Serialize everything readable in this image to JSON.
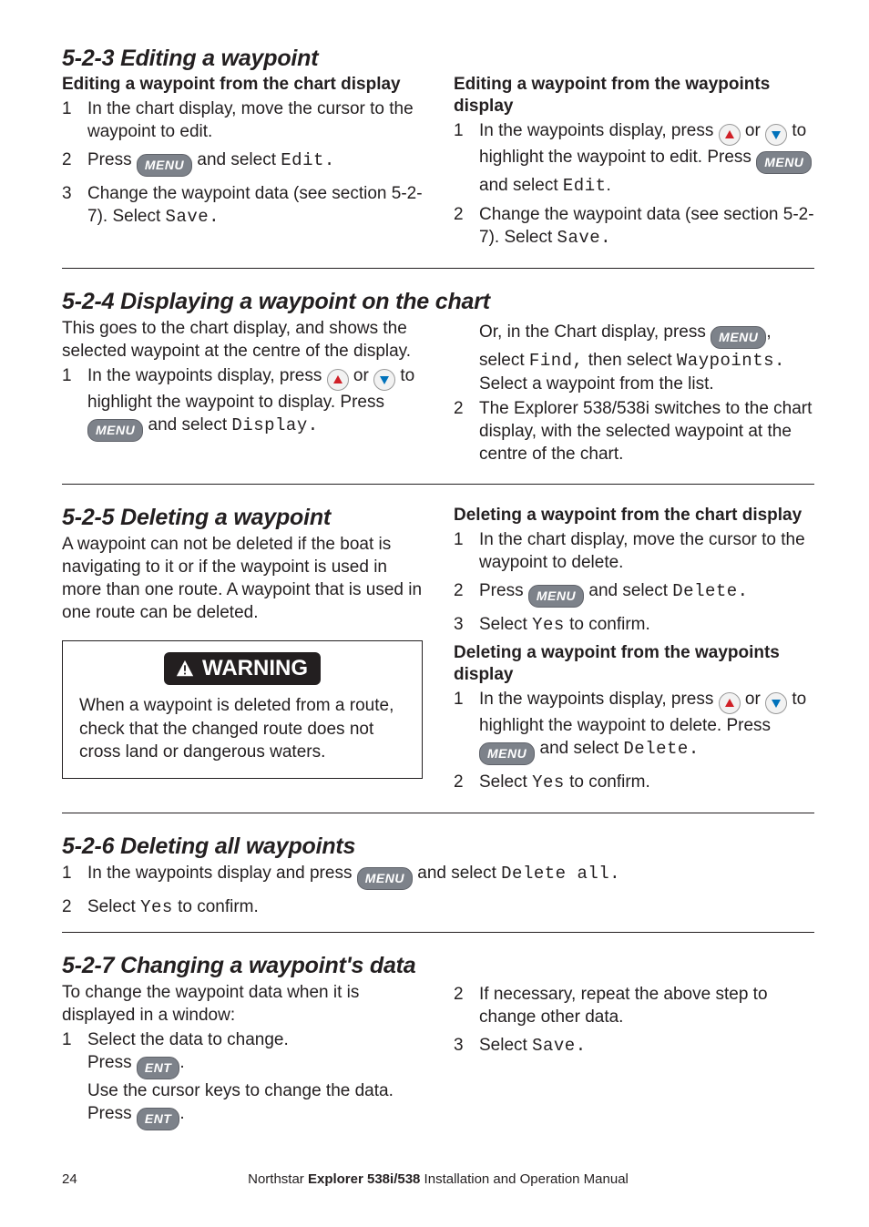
{
  "buttons": {
    "menu": "MENU",
    "ent": "ENT"
  },
  "s523": {
    "title": "5-2-3 Editing a waypoint",
    "left": {
      "heading": "Editing a waypoint from the chart display",
      "step1": "In the chart display, move the cursor to the waypoint to edit.",
      "step2a": "Press ",
      "step2b": " and select ",
      "step2c": "Edit.",
      "step3a": "Change the waypoint data (see section 5-2-7). Select ",
      "step3b": "Save."
    },
    "right": {
      "heading": "Editing a waypoint from the waypoints display",
      "step1a": "In the waypoints display, press ",
      "step1b": " or ",
      "step1c": " to highlight the waypoint to edit. Press ",
      "step1d": " and select ",
      "step1e": "Edit",
      "step1f": ".",
      "step2a": "Change the waypoint data (see section 5-2-7). Select ",
      "step2b": "Save."
    }
  },
  "s524": {
    "title": "5-2-4 Displaying a waypoint on the chart",
    "left": {
      "intro": "This goes to the chart display, and shows the selected waypoint at the centre of the display.",
      "step1a": "In the waypoints display, press ",
      "step1b": " or ",
      "step1c": " to highlight the waypoint to display. Press ",
      "step1d": " and select ",
      "step1e": "Display."
    },
    "right": {
      "alt1": "Or, in the Chart display, press ",
      "alt2": ", select ",
      "alt3": "Find,",
      "alt4": " then select ",
      "alt5": "Waypoints.",
      "alt6": " Select a waypoint from the list.",
      "step2": "The Explorer 538/538i switches to the chart display, with the selected waypoint at the centre of the chart."
    }
  },
  "s525": {
    "title": "5-2-5 Deleting a waypoint",
    "left": {
      "intro": "A waypoint can not be deleted if the boat is navigating to it or if the waypoint is used in more than one route. A waypoint that is used in one route can be deleted.",
      "warn_label": "WARNING",
      "warn_body": "When a waypoint is deleted from a route, check that the changed route does not cross land or dangerous waters."
    },
    "right": {
      "heading1": "Deleting a waypoint from the chart display",
      "a1": "In the chart display, move the cursor to the waypoint to delete.",
      "a2a": "Press ",
      "a2b": " and select ",
      "a2c": "Delete.",
      "a3a": "Select ",
      "a3b": "Yes",
      "a3c": " to confirm.",
      "heading2": "Deleting a waypoint from the waypoints display",
      "b1a": "In the waypoints display, press ",
      "b1b": " or ",
      "b1c": " to highlight the waypoint to delete. Press ",
      "b1d": " and select ",
      "b1e": "Delete.",
      "b2a": "Select ",
      "b2b": "Yes",
      "b2c": " to confirm."
    }
  },
  "s526": {
    "title": "5-2-6 Deleting all waypoints",
    "step1a": "In the waypoints display and press ",
    "step1b": " and select ",
    "step1c": "Delete all.",
    "step2a": "Select ",
    "step2b": "Yes",
    "step2c": "  to confirm."
  },
  "s527": {
    "title": "5-2-7 Changing a waypoint's data",
    "left": {
      "intro": "To change the waypoint data when it is displayed in a window:",
      "step1": "Select the data to change.",
      "pressa": "Press ",
      "pressb": ".",
      "cursor": "Use the cursor keys to change the data."
    },
    "right": {
      "step2": "If necessary, repeat the above step to change other data.",
      "step3a": "Select ",
      "step3b": "Save."
    }
  },
  "footer": {
    "page": "24",
    "txt1": "Northstar ",
    "txt2": "Explorer 538i/538",
    "txt3": "  Installation and Operation Manual"
  }
}
